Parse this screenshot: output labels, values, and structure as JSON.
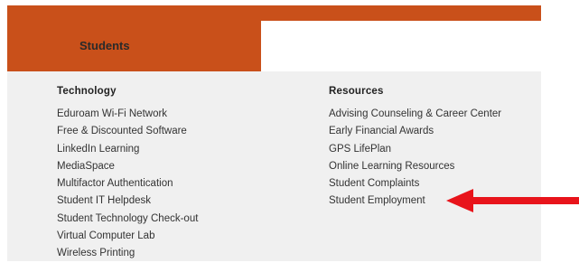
{
  "tabs": {
    "active_label": "Students"
  },
  "technology": {
    "heading": "Technology",
    "links": [
      "Eduroam Wi-Fi Network",
      "Free & Discounted Software",
      "LinkedIn Learning",
      "MediaSpace",
      "Multifactor Authentication",
      "Student IT Helpdesk",
      "Student Technology Check-out",
      "Virtual Computer Lab",
      "Wireless Printing"
    ]
  },
  "resources": {
    "heading": "Resources",
    "links": [
      "Advising Counseling & Career Center",
      "Early Financial Awards",
      "GPS LifePlan",
      "Online Learning Resources",
      "Student Complaints",
      "Student Employment"
    ]
  },
  "colors": {
    "brand_orange": "#c9501a",
    "panel_bg": "#f0f0f0",
    "annotation_arrow": "#e8141b"
  },
  "annotation": {
    "icon": "red-arrow-left-icon",
    "points_to": "Student Employment"
  }
}
